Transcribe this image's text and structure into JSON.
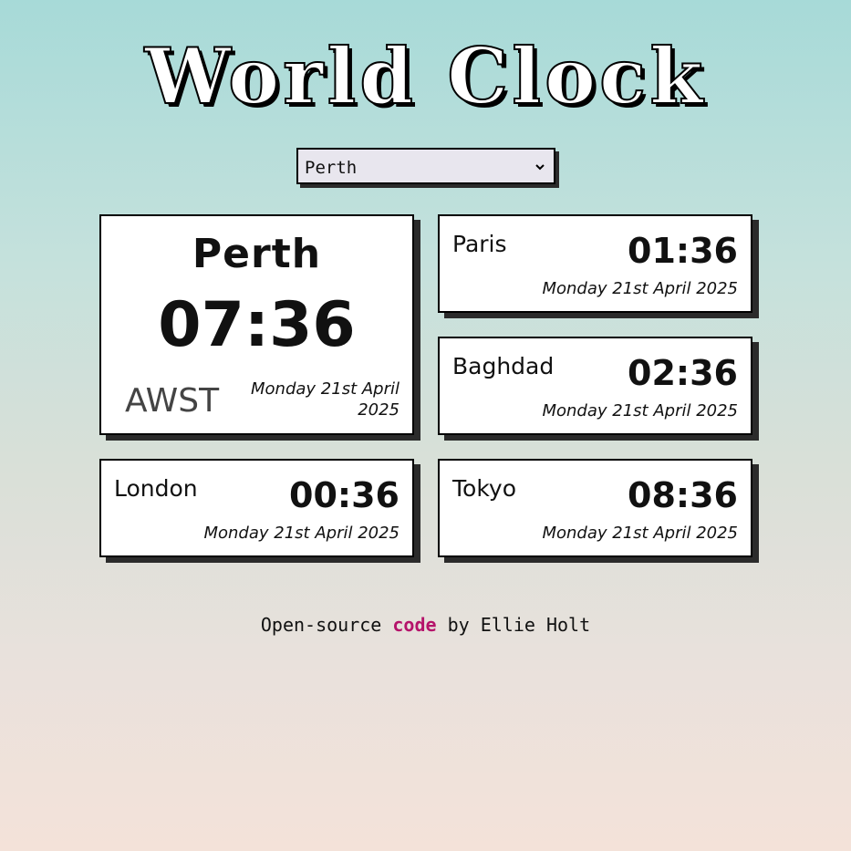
{
  "app": {
    "title": "World Clock"
  },
  "selector": {
    "selected": "Perth",
    "icon": "chevron-down-icon"
  },
  "main_clock": {
    "city": "Perth",
    "time": "07:36",
    "timezone": "AWST",
    "date": "Monday 21st April 2025"
  },
  "clocks": [
    {
      "city": "Paris",
      "time": "01:36",
      "date": "Monday 21st April 2025"
    },
    {
      "city": "Baghdad",
      "time": "02:36",
      "date": "Monday 21st April 2025"
    },
    {
      "city": "London",
      "time": "00:36",
      "date": "Monday 21st April 2025"
    },
    {
      "city": "Tokyo",
      "time": "08:36",
      "date": "Monday 21st April 2025"
    }
  ],
  "footer": {
    "prefix": "Open-source",
    "link_label": "code",
    "suffix": "by Ellie Holt"
  },
  "colors": {
    "link": "#b5136a",
    "card_shadow": "#2b2b2b",
    "background_top": "#a7dad8",
    "background_bottom": "#f4e2d9"
  }
}
